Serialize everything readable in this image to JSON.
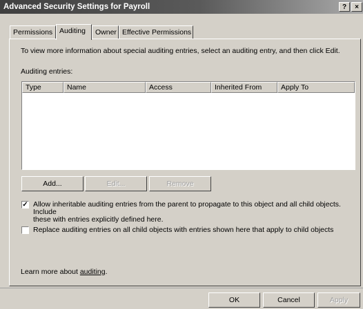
{
  "window": {
    "title": "Advanced Security Settings for Payroll",
    "help_label": "?",
    "close_label": "×"
  },
  "tabs": [
    {
      "label": "Permissions",
      "active": false
    },
    {
      "label": "Auditing",
      "active": true
    },
    {
      "label": "Owner",
      "active": false
    },
    {
      "label": "Effective Permissions",
      "active": false
    }
  ],
  "intro_text": "To view more information about special auditing entries, select an auditing entry, and then click Edit.",
  "auditing_entries_label": "Auditing entries:",
  "table": {
    "columns": [
      "Type",
      "Name",
      "Access",
      "Inherited From",
      "Apply To"
    ],
    "rows": []
  },
  "buttons": {
    "add": "Add...",
    "edit": "Edit...",
    "remove": "Remove"
  },
  "options": {
    "inherit_label_line1": "Allow inheritable auditing entries from the parent to propagate to this object and all child objects. Include",
    "inherit_label_line2": "these with entries explicitly defined here.",
    "inherit_checked": true,
    "replace_label": "Replace auditing entries on all child objects with entries shown here that apply to child objects",
    "replace_checked": false
  },
  "learn_more": {
    "prefix": "Learn more about ",
    "link": "auditing",
    "suffix": "."
  },
  "footer": {
    "ok": "OK",
    "cancel": "Cancel",
    "apply": "Apply"
  },
  "icons": {
    "check": "✓"
  }
}
